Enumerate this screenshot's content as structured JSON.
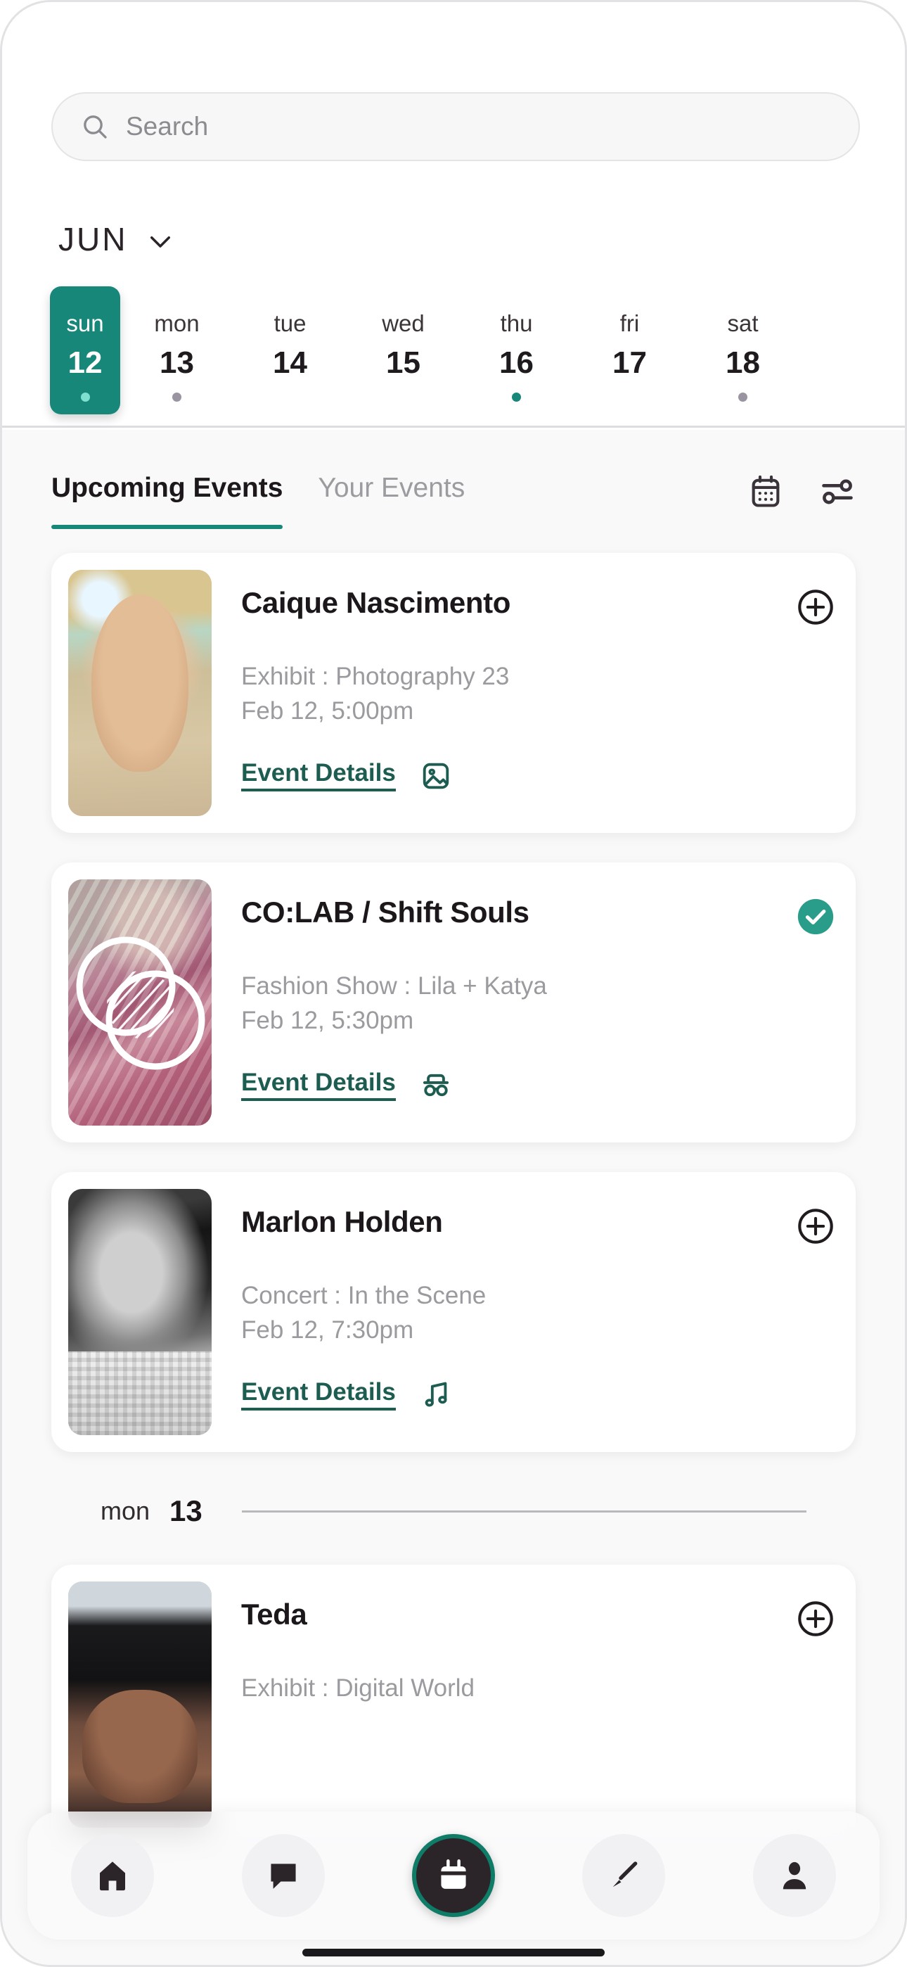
{
  "search": {
    "placeholder": "Search",
    "value": "",
    "icon": "search-icon"
  },
  "calendar": {
    "month": "JUN",
    "chevron_icon": "chevron-down-icon",
    "days": [
      {
        "name": "sun",
        "num": "12",
        "selected": true,
        "dot": "teal"
      },
      {
        "name": "mon",
        "num": "13",
        "selected": false,
        "dot": "gray"
      },
      {
        "name": "tue",
        "num": "14",
        "selected": false,
        "dot": "none"
      },
      {
        "name": "wed",
        "num": "15",
        "selected": false,
        "dot": "none"
      },
      {
        "name": "thu",
        "num": "16",
        "selected": false,
        "dot": "teal"
      },
      {
        "name": "fri",
        "num": "17",
        "selected": false,
        "dot": "none"
      },
      {
        "name": "sat",
        "num": "18",
        "selected": false,
        "dot": "gray"
      }
    ]
  },
  "tabs": {
    "items": [
      {
        "label": "Upcoming Events",
        "active": true
      },
      {
        "label": "Your Events",
        "active": false
      }
    ],
    "actions": [
      {
        "icon": "calendar-icon"
      },
      {
        "icon": "filter-sliders-icon"
      }
    ]
  },
  "events": [
    {
      "title": "Caique Nascimento",
      "subtitle": "Exhibit : Photography 23",
      "time": "Feb 12, 5:00pm",
      "details_label": "Event Details",
      "kind_icon": "image-icon",
      "action": "add",
      "action_icon": "plus-circle-icon"
    },
    {
      "title": "CO:LAB / Shift Souls",
      "subtitle": "Fashion Show : Lila + Katya",
      "time": "Feb 12, 5:30pm",
      "details_label": "Event Details",
      "kind_icon": "incognito-glasses-icon",
      "action": "saved",
      "action_icon": "check-circle-icon"
    },
    {
      "title": "Marlon Holden",
      "subtitle": "Concert : In the Scene",
      "time": "Feb 12, 7:30pm",
      "details_label": "Event Details",
      "kind_icon": "music-note-icon",
      "action": "add",
      "action_icon": "plus-circle-icon"
    }
  ],
  "day_divider": {
    "name": "mon",
    "num": "13"
  },
  "next_day_events": [
    {
      "title": "Teda",
      "subtitle": "Exhibit : Digital World",
      "action": "add",
      "action_icon": "plus-circle-icon"
    }
  ],
  "bottom_nav": [
    {
      "icon": "home-icon",
      "active": false
    },
    {
      "icon": "chat-icon",
      "active": false
    },
    {
      "icon": "calendar-icon",
      "active": true
    },
    {
      "icon": "paintbrush-icon",
      "active": false
    },
    {
      "icon": "profile-icon",
      "active": false
    }
  ],
  "colors": {
    "accent_teal": "#17877a",
    "accent_teal_light": "#2a9d8a",
    "link_teal": "#1d5c50",
    "nav_active_bg": "#2b2529",
    "nav_active_ring": "#0f7c68",
    "header_bg": "#ffffff",
    "body_bg": "#f9f9fa",
    "muted_text": "#9a9a9f"
  }
}
